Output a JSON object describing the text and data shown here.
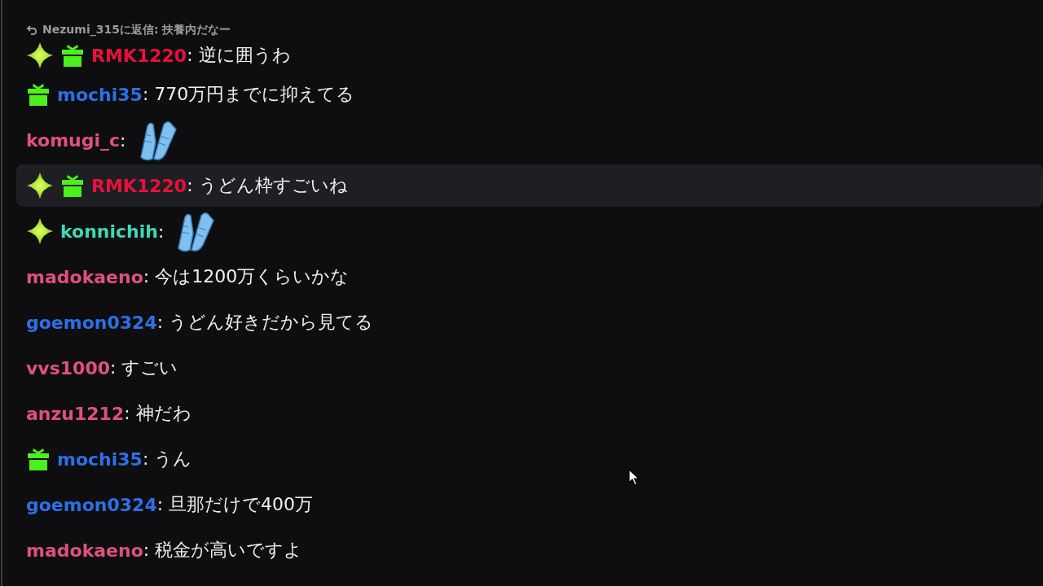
{
  "chat": {
    "messages": [
      {
        "reply": "Nezumi_315に返信: 扶養内だなー",
        "badges": [
          {
            "kind": "sparkle"
          },
          {
            "kind": "gift"
          }
        ],
        "user": "RMK1220",
        "color": "#e8103c",
        "text": ": 逆に囲うわ",
        "highlighted": false
      },
      {
        "badges": [
          {
            "kind": "gift"
          }
        ],
        "user": "mochi35",
        "color": "#2e6fe6",
        "text": ": 770万円までに抑えてる",
        "highlighted": false
      },
      {
        "user": "komugi_c",
        "color": "#e0507e",
        "text": ":",
        "emote": {
          "kind": "clap"
        },
        "highlighted": false
      },
      {
        "badges": [
          {
            "kind": "sparkle"
          },
          {
            "kind": "gift"
          }
        ],
        "user": "RMK1220",
        "color": "#e8103c",
        "text": ": うどん枠すごいね",
        "highlighted": true
      },
      {
        "badges": [
          {
            "kind": "sparkle"
          }
        ],
        "user": "konnichih",
        "color": "#3fd8b4",
        "text": ":",
        "emote": {
          "kind": "clap"
        },
        "highlighted": false
      },
      {
        "user": "madokaeno",
        "color": "#e0507e",
        "text": ": 今は1200万くらいかな",
        "highlighted": false
      },
      {
        "user": "goemon0324",
        "color": "#2e6fe6",
        "text": ": うどん好きだから見てる",
        "highlighted": false
      },
      {
        "user": "vvs1000",
        "color": "#e0507e",
        "text": ": すごい",
        "highlighted": false
      },
      {
        "user": "anzu1212",
        "color": "#e0507e",
        "text": ": 神だわ",
        "highlighted": false
      },
      {
        "badges": [
          {
            "kind": "gift"
          }
        ],
        "user": "mochi35",
        "color": "#2e6fe6",
        "text": ": うん",
        "highlighted": false
      },
      {
        "user": "goemon0324",
        "color": "#2e6fe6",
        "text": ": 旦那だけで400万",
        "highlighted": false
      },
      {
        "user": "madokaeno",
        "color": "#e0507e",
        "text": ": 税金が高いですよ",
        "highlighted": false
      }
    ]
  }
}
